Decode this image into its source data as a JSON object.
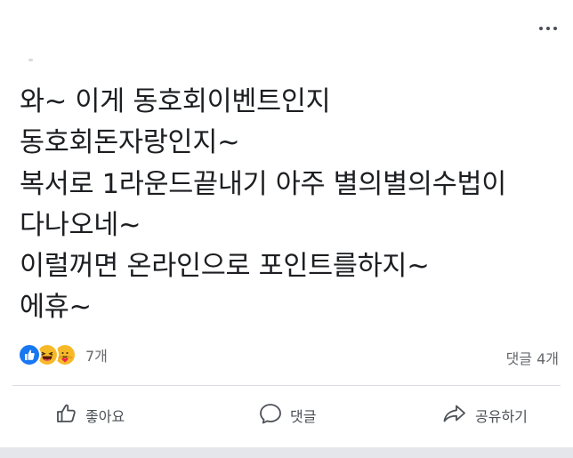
{
  "post": {
    "lines": [
      "와~ 이게 동호회이벤트인지",
      "동호회돈자랑인지~",
      "복서로 1라운드끝내기 아주 별의별의수법이",
      "다나오네~",
      "이럴꺼면 온라인으로 포인트를하지~",
      "에휴~"
    ]
  },
  "reactions": {
    "icons": [
      "like-icon",
      "haha-icon",
      "care-icon"
    ],
    "count_label": "7개"
  },
  "comments": {
    "count_label": "댓글 4개"
  },
  "actions": {
    "like_label": "좋아요",
    "comment_label": "댓글",
    "share_label": "공유하기"
  },
  "colors": {
    "like_blue": "#1877f2",
    "emoji_yellow": "#f7b928",
    "text_primary": "#1c1e21",
    "text_secondary": "#65676b",
    "divider": "#dadde1"
  }
}
